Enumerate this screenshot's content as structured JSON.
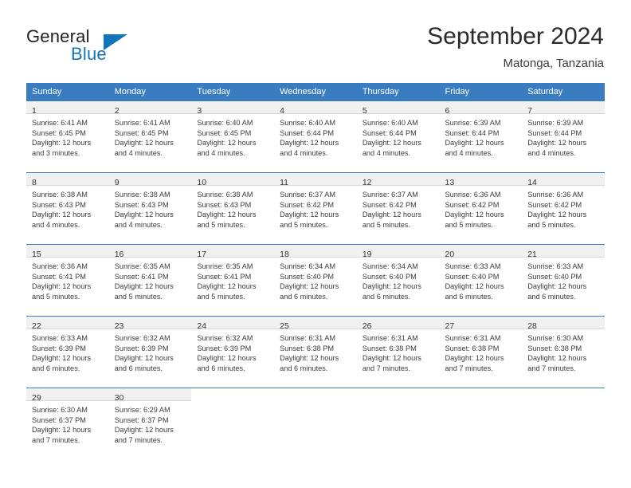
{
  "logo": {
    "word1": "General",
    "word2": "Blue",
    "triangle_icon": "triangle-icon",
    "color_primary": "#1275bc",
    "color_text": "#231f20"
  },
  "header": {
    "title": "September 2024",
    "subtitle": "Matonga, Tanzania"
  },
  "calendar": {
    "accent_color": "#3a7cc0",
    "daynum_band_color": "#f1f1f1",
    "weekday_headers": [
      "Sunday",
      "Monday",
      "Tuesday",
      "Wednesday",
      "Thursday",
      "Friday",
      "Saturday"
    ],
    "weeks": [
      [
        {
          "day": "1",
          "sunrise": "Sunrise: 6:41 AM",
          "sunset": "Sunset: 6:45 PM",
          "daylight1": "Daylight: 12 hours",
          "daylight2": "and 3 minutes."
        },
        {
          "day": "2",
          "sunrise": "Sunrise: 6:41 AM",
          "sunset": "Sunset: 6:45 PM",
          "daylight1": "Daylight: 12 hours",
          "daylight2": "and 4 minutes."
        },
        {
          "day": "3",
          "sunrise": "Sunrise: 6:40 AM",
          "sunset": "Sunset: 6:45 PM",
          "daylight1": "Daylight: 12 hours",
          "daylight2": "and 4 minutes."
        },
        {
          "day": "4",
          "sunrise": "Sunrise: 6:40 AM",
          "sunset": "Sunset: 6:44 PM",
          "daylight1": "Daylight: 12 hours",
          "daylight2": "and 4 minutes."
        },
        {
          "day": "5",
          "sunrise": "Sunrise: 6:40 AM",
          "sunset": "Sunset: 6:44 PM",
          "daylight1": "Daylight: 12 hours",
          "daylight2": "and 4 minutes."
        },
        {
          "day": "6",
          "sunrise": "Sunrise: 6:39 AM",
          "sunset": "Sunset: 6:44 PM",
          "daylight1": "Daylight: 12 hours",
          "daylight2": "and 4 minutes."
        },
        {
          "day": "7",
          "sunrise": "Sunrise: 6:39 AM",
          "sunset": "Sunset: 6:44 PM",
          "daylight1": "Daylight: 12 hours",
          "daylight2": "and 4 minutes."
        }
      ],
      [
        {
          "day": "8",
          "sunrise": "Sunrise: 6:38 AM",
          "sunset": "Sunset: 6:43 PM",
          "daylight1": "Daylight: 12 hours",
          "daylight2": "and 4 minutes."
        },
        {
          "day": "9",
          "sunrise": "Sunrise: 6:38 AM",
          "sunset": "Sunset: 6:43 PM",
          "daylight1": "Daylight: 12 hours",
          "daylight2": "and 4 minutes."
        },
        {
          "day": "10",
          "sunrise": "Sunrise: 6:38 AM",
          "sunset": "Sunset: 6:43 PM",
          "daylight1": "Daylight: 12 hours",
          "daylight2": "and 5 minutes."
        },
        {
          "day": "11",
          "sunrise": "Sunrise: 6:37 AM",
          "sunset": "Sunset: 6:42 PM",
          "daylight1": "Daylight: 12 hours",
          "daylight2": "and 5 minutes."
        },
        {
          "day": "12",
          "sunrise": "Sunrise: 6:37 AM",
          "sunset": "Sunset: 6:42 PM",
          "daylight1": "Daylight: 12 hours",
          "daylight2": "and 5 minutes."
        },
        {
          "day": "13",
          "sunrise": "Sunrise: 6:36 AM",
          "sunset": "Sunset: 6:42 PM",
          "daylight1": "Daylight: 12 hours",
          "daylight2": "and 5 minutes."
        },
        {
          "day": "14",
          "sunrise": "Sunrise: 6:36 AM",
          "sunset": "Sunset: 6:42 PM",
          "daylight1": "Daylight: 12 hours",
          "daylight2": "and 5 minutes."
        }
      ],
      [
        {
          "day": "15",
          "sunrise": "Sunrise: 6:36 AM",
          "sunset": "Sunset: 6:41 PM",
          "daylight1": "Daylight: 12 hours",
          "daylight2": "and 5 minutes."
        },
        {
          "day": "16",
          "sunrise": "Sunrise: 6:35 AM",
          "sunset": "Sunset: 6:41 PM",
          "daylight1": "Daylight: 12 hours",
          "daylight2": "and 5 minutes."
        },
        {
          "day": "17",
          "sunrise": "Sunrise: 6:35 AM",
          "sunset": "Sunset: 6:41 PM",
          "daylight1": "Daylight: 12 hours",
          "daylight2": "and 5 minutes."
        },
        {
          "day": "18",
          "sunrise": "Sunrise: 6:34 AM",
          "sunset": "Sunset: 6:40 PM",
          "daylight1": "Daylight: 12 hours",
          "daylight2": "and 6 minutes."
        },
        {
          "day": "19",
          "sunrise": "Sunrise: 6:34 AM",
          "sunset": "Sunset: 6:40 PM",
          "daylight1": "Daylight: 12 hours",
          "daylight2": "and 6 minutes."
        },
        {
          "day": "20",
          "sunrise": "Sunrise: 6:33 AM",
          "sunset": "Sunset: 6:40 PM",
          "daylight1": "Daylight: 12 hours",
          "daylight2": "and 6 minutes."
        },
        {
          "day": "21",
          "sunrise": "Sunrise: 6:33 AM",
          "sunset": "Sunset: 6:40 PM",
          "daylight1": "Daylight: 12 hours",
          "daylight2": "and 6 minutes."
        }
      ],
      [
        {
          "day": "22",
          "sunrise": "Sunrise: 6:33 AM",
          "sunset": "Sunset: 6:39 PM",
          "daylight1": "Daylight: 12 hours",
          "daylight2": "and 6 minutes."
        },
        {
          "day": "23",
          "sunrise": "Sunrise: 6:32 AM",
          "sunset": "Sunset: 6:39 PM",
          "daylight1": "Daylight: 12 hours",
          "daylight2": "and 6 minutes."
        },
        {
          "day": "24",
          "sunrise": "Sunrise: 6:32 AM",
          "sunset": "Sunset: 6:39 PM",
          "daylight1": "Daylight: 12 hours",
          "daylight2": "and 6 minutes."
        },
        {
          "day": "25",
          "sunrise": "Sunrise: 6:31 AM",
          "sunset": "Sunset: 6:38 PM",
          "daylight1": "Daylight: 12 hours",
          "daylight2": "and 6 minutes."
        },
        {
          "day": "26",
          "sunrise": "Sunrise: 6:31 AM",
          "sunset": "Sunset: 6:38 PM",
          "daylight1": "Daylight: 12 hours",
          "daylight2": "and 7 minutes."
        },
        {
          "day": "27",
          "sunrise": "Sunrise: 6:31 AM",
          "sunset": "Sunset: 6:38 PM",
          "daylight1": "Daylight: 12 hours",
          "daylight2": "and 7 minutes."
        },
        {
          "day": "28",
          "sunrise": "Sunrise: 6:30 AM",
          "sunset": "Sunset: 6:38 PM",
          "daylight1": "Daylight: 12 hours",
          "daylight2": "and 7 minutes."
        }
      ],
      [
        {
          "day": "29",
          "sunrise": "Sunrise: 6:30 AM",
          "sunset": "Sunset: 6:37 PM",
          "daylight1": "Daylight: 12 hours",
          "daylight2": "and 7 minutes."
        },
        {
          "day": "30",
          "sunrise": "Sunrise: 6:29 AM",
          "sunset": "Sunset: 6:37 PM",
          "daylight1": "Daylight: 12 hours",
          "daylight2": "and 7 minutes."
        },
        {
          "day": "",
          "sunrise": "",
          "sunset": "",
          "daylight1": "",
          "daylight2": ""
        },
        {
          "day": "",
          "sunrise": "",
          "sunset": "",
          "daylight1": "",
          "daylight2": ""
        },
        {
          "day": "",
          "sunrise": "",
          "sunset": "",
          "daylight1": "",
          "daylight2": ""
        },
        {
          "day": "",
          "sunrise": "",
          "sunset": "",
          "daylight1": "",
          "daylight2": ""
        },
        {
          "day": "",
          "sunrise": "",
          "sunset": "",
          "daylight1": "",
          "daylight2": ""
        }
      ]
    ]
  }
}
